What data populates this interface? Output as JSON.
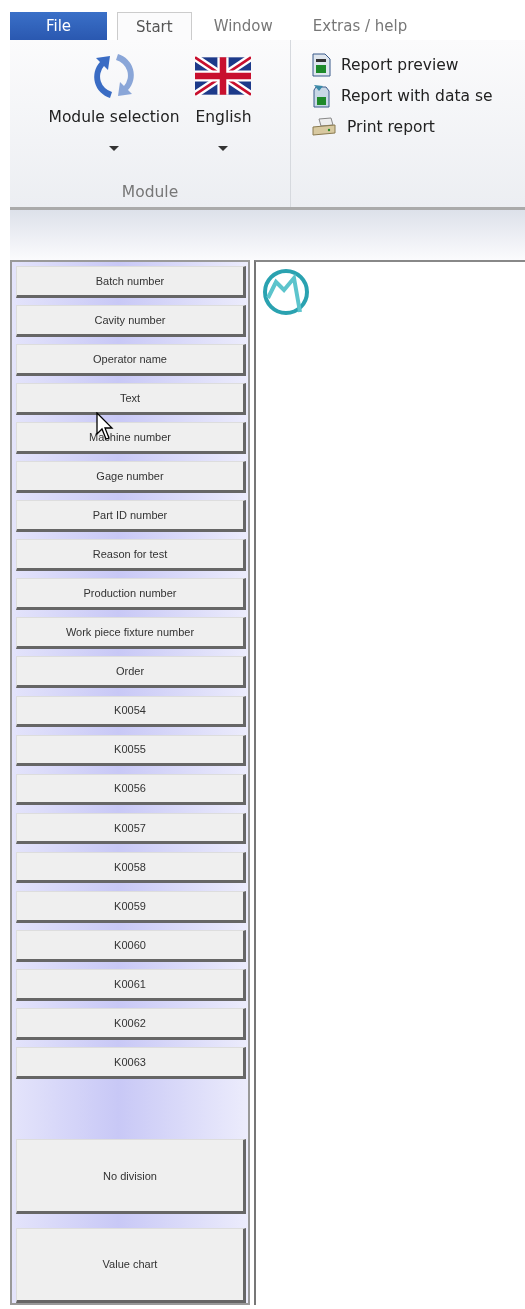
{
  "tabs": [
    {
      "label": "File",
      "kind": "application",
      "selected": false
    },
    {
      "label": "Start",
      "kind": "tab",
      "selected": true
    },
    {
      "label": "Window",
      "kind": "tab",
      "selected": false
    },
    {
      "label": "Extras / help",
      "kind": "tab",
      "selected": false
    }
  ],
  "ribbon": {
    "module_group": {
      "label": "Module",
      "buttons": [
        {
          "label": "Module selection"
        },
        {
          "label": "English"
        }
      ]
    },
    "report_items": [
      {
        "label": "Report preview"
      },
      {
        "label": "Report with data se"
      },
      {
        "label": "Print report"
      }
    ]
  },
  "field_buttons": [
    "Batch number",
    "Cavity number",
    "Operator name",
    "Text",
    "Machine number",
    "Gage number",
    "Part ID number",
    "Reason for test",
    "Production number",
    "Work piece fixture number",
    "Order",
    "K0054",
    "K0055",
    "K0056",
    "K0057",
    "K0058",
    "K0059",
    "K0060",
    "K0061",
    "K0062",
    "K0063"
  ],
  "mode_buttons": [
    "No division",
    "Value chart"
  ]
}
